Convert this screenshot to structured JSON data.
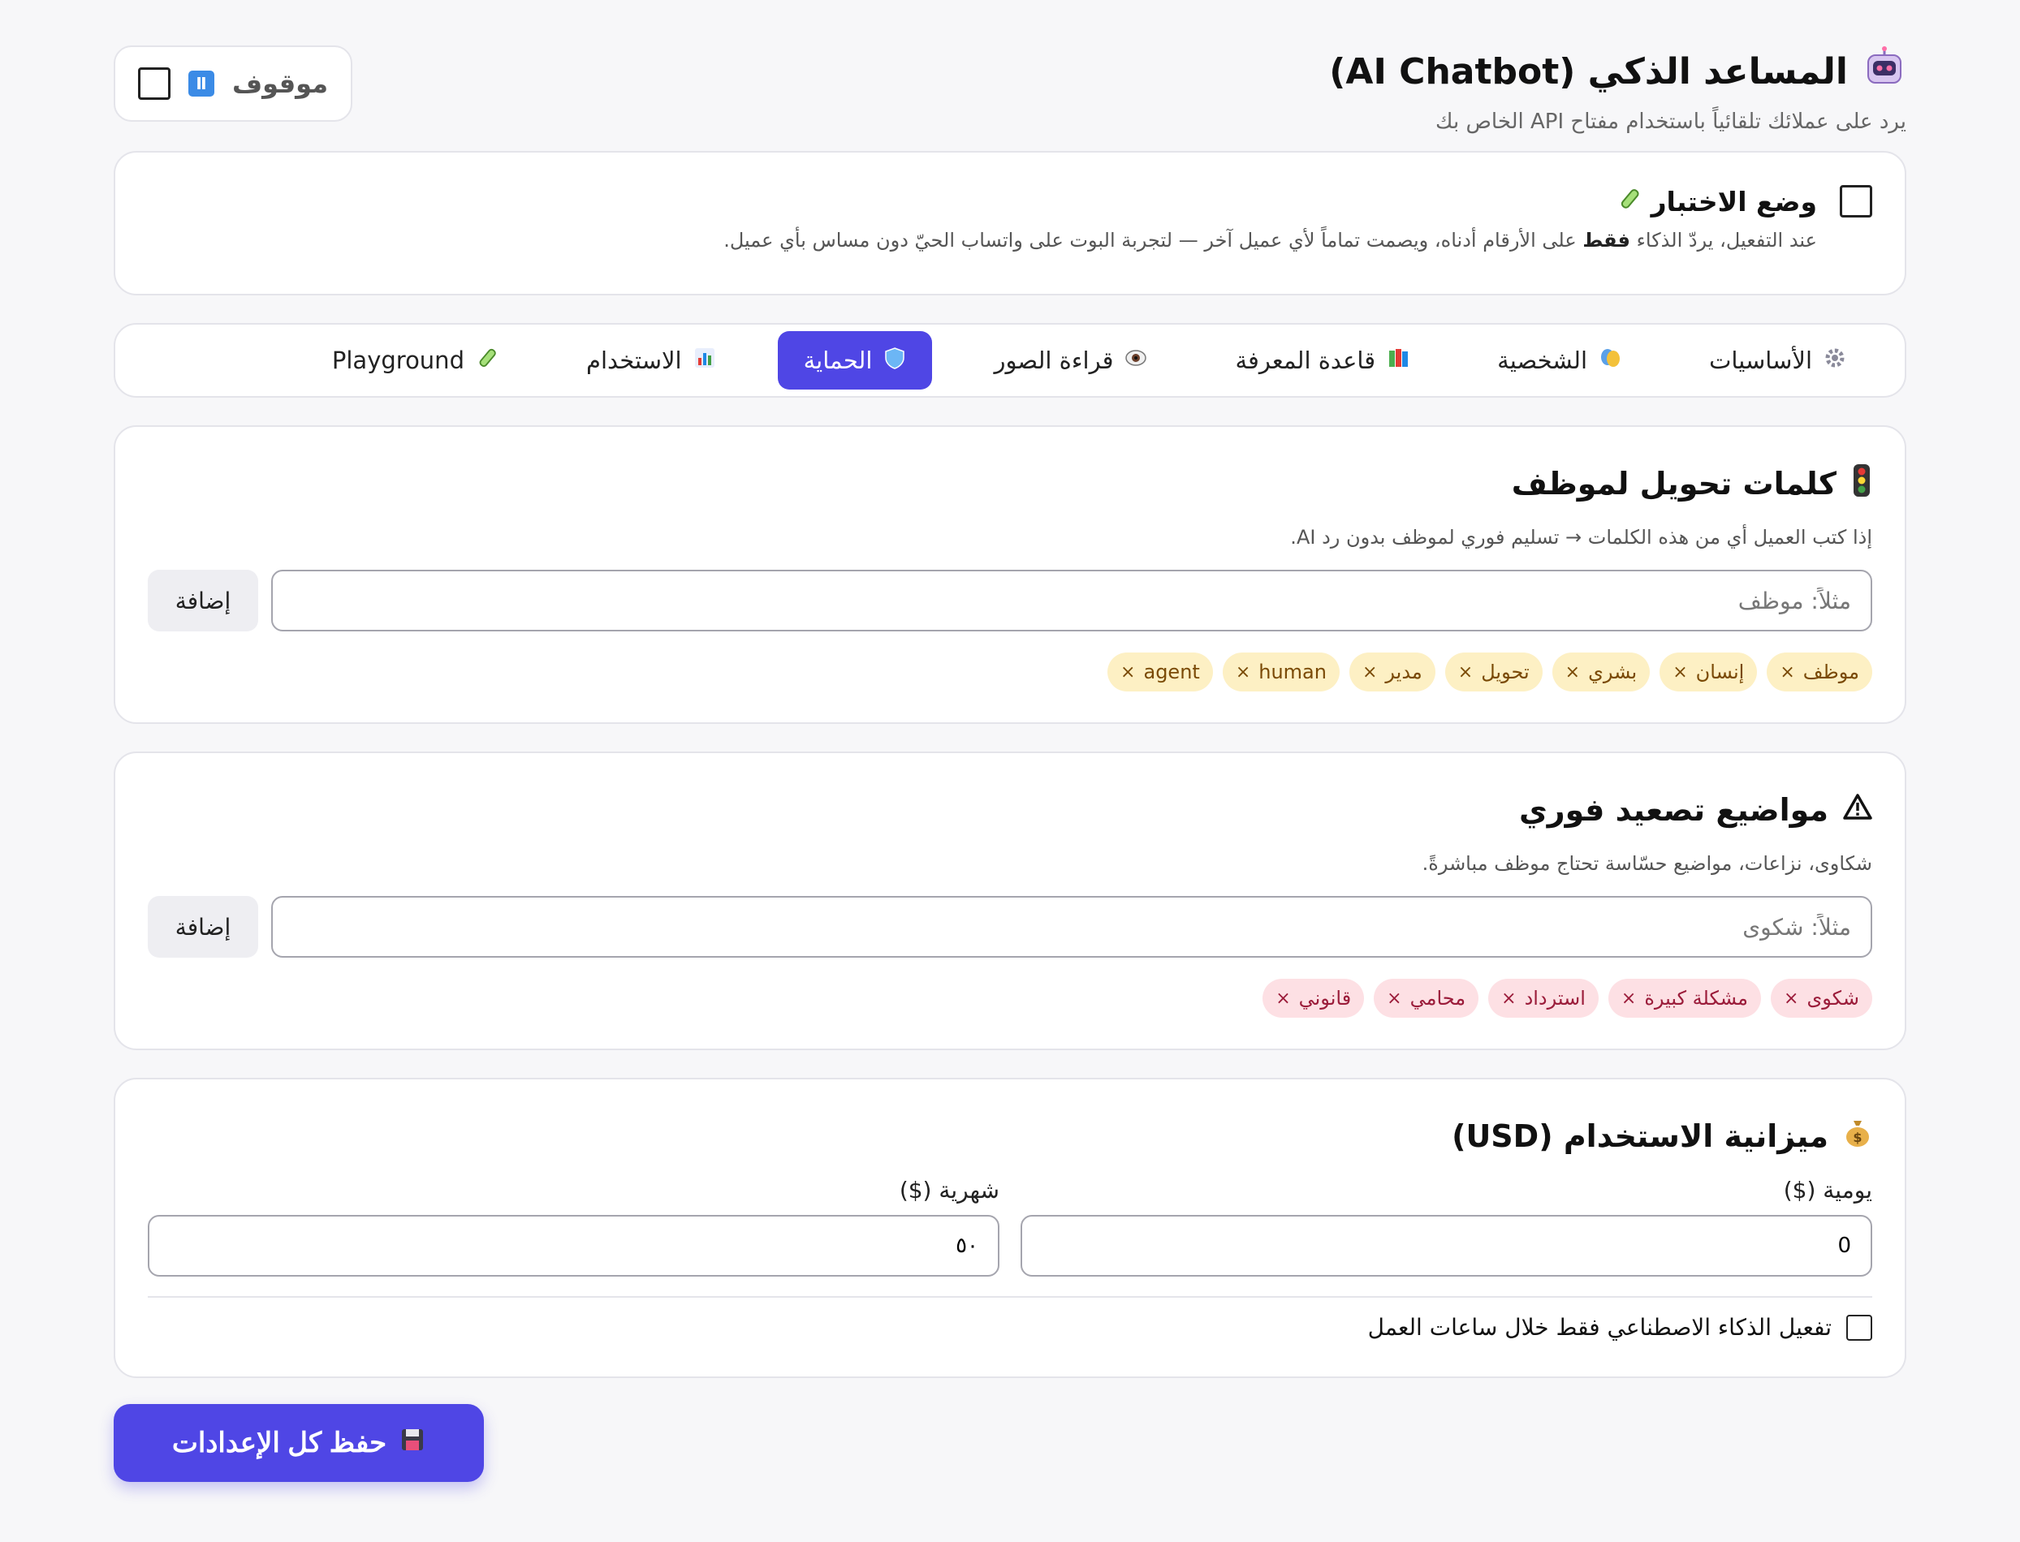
{
  "header": {
    "icon": "robot-icon",
    "title": "المساعد الذكي (AI Chatbot)",
    "subtitle": "يرد على عملائك تلقائياً باستخدام مفتاح API الخاص بك",
    "status_label": "موقوف",
    "status_icon": "pause-icon"
  },
  "test_mode": {
    "title": "وضع الاختبار",
    "icon": "test-tube-icon",
    "desc_before": "عند التفعيل، يردّ الذكاء ",
    "desc_bold": "فقط",
    "desc_after": " على الأرقام أدناه، ويصمت تماماً لأي عميل آخر — لتجربة البوت على واتساب الحيّ دون مساس بأي عميل."
  },
  "tabs": [
    {
      "label": "الأساسيات",
      "icon": "gear-icon"
    },
    {
      "label": "الشخصية",
      "icon": "theater-masks-icon"
    },
    {
      "label": "قاعدة المعرفة",
      "icon": "books-icon"
    },
    {
      "label": "قراءة الصور",
      "icon": "eye-icon"
    },
    {
      "label": "الحماية",
      "icon": "shield-icon",
      "active": true
    },
    {
      "label": "الاستخدام",
      "icon": "bar-chart-icon"
    },
    {
      "label": "Playground",
      "icon": "test-tube-icon"
    }
  ],
  "handoff": {
    "title": "كلمات تحويل لموظف",
    "icon": "traffic-light-icon",
    "desc": "إذا كتب العميل أي من هذه الكلمات → تسليم فوري لموظف بدون رد AI.",
    "placeholder": "مثلاً: موظف",
    "add_label": "إضافة",
    "keywords": [
      "موظف",
      "إنسان",
      "بشري",
      "تحويل",
      "مدير",
      "human",
      "agent"
    ]
  },
  "escalation": {
    "title": "مواضيع تصعيد فوري",
    "icon": "warning-icon",
    "desc": "شكاوى، نزاعات، مواضيع حسّاسة تحتاج موظف مباشرةً.",
    "placeholder": "مثلاً: شكوى",
    "add_label": "إضافة",
    "topics": [
      "شكوى",
      "مشكلة كبيرة",
      "استرداد",
      "محامي",
      "قانوني"
    ]
  },
  "budget": {
    "title": "ميزانية الاستخدام (USD)",
    "icon": "money-bag-icon",
    "daily_label": "يومية ($)",
    "daily_value": "0",
    "monthly_label": "شهرية ($)",
    "monthly_value": "٥٠",
    "hours_only_label": "تفعيل الذكاء الاصطناعي فقط خلال ساعات العمل"
  },
  "save": {
    "label": "حفظ كل الإعدادات",
    "icon": "floppy-disk-icon"
  },
  "colors": {
    "accent": "#4f46e5",
    "chip_yellow": "#fdf0c4",
    "chip_pink": "#fde0e4"
  }
}
